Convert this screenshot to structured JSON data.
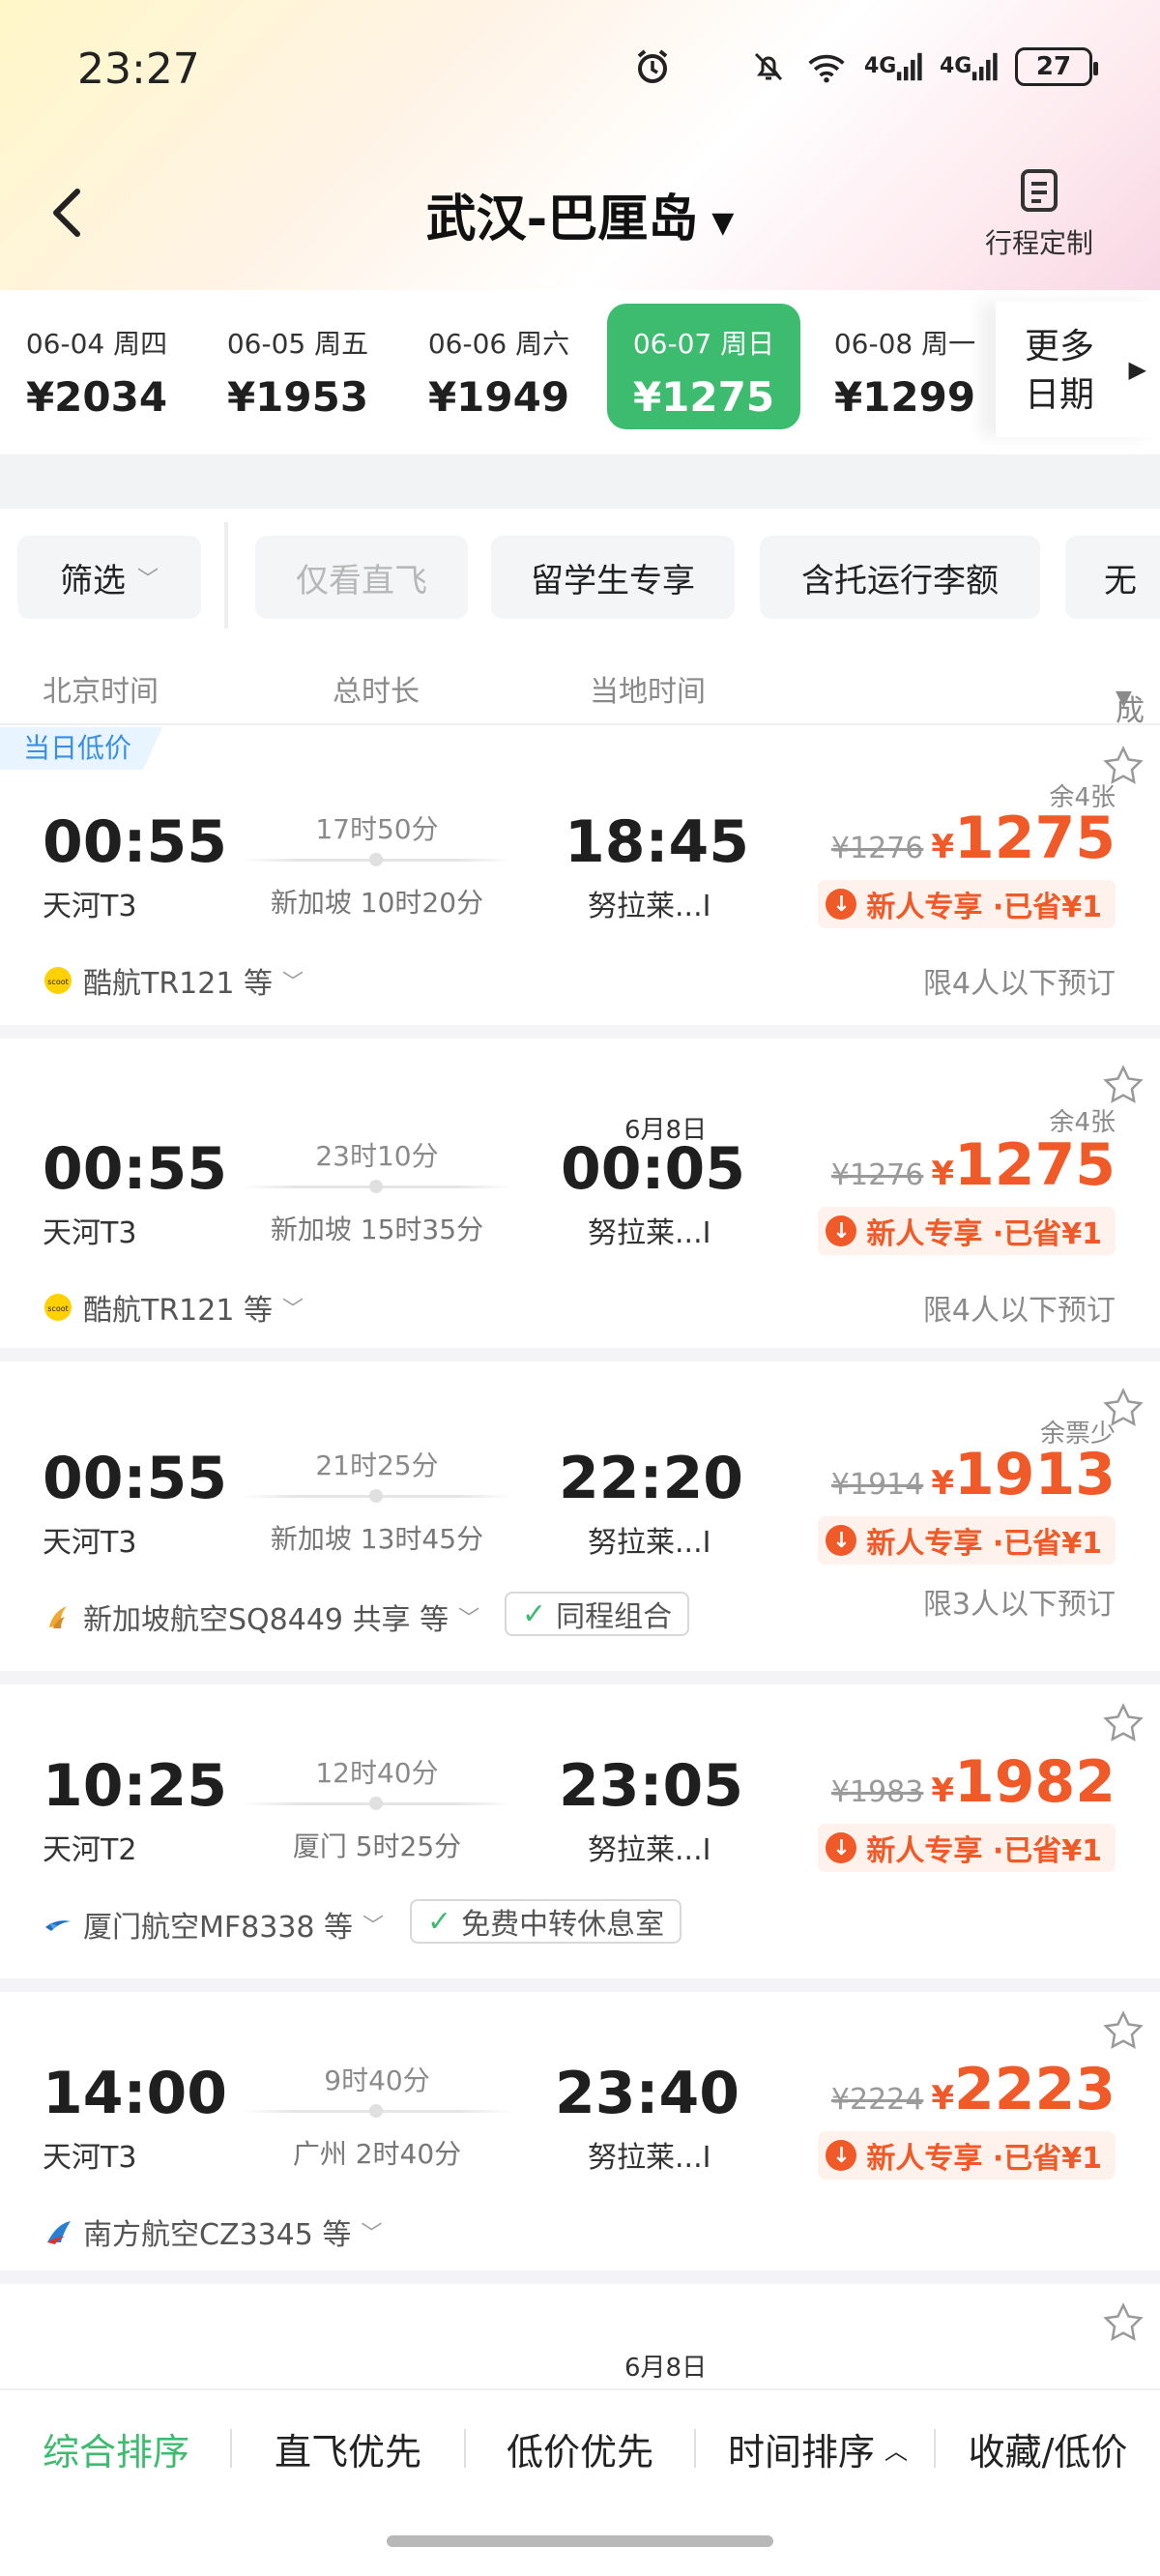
{
  "status_bar": {
    "time": "23:27",
    "network_1": "4G",
    "network_2": "4G",
    "battery": "27"
  },
  "nav": {
    "title": "武汉-巴厘岛",
    "custom_trip_label": "行程定制"
  },
  "dates": [
    {
      "date": "06-04 周四",
      "price": "¥2034"
    },
    {
      "date": "06-05 周五",
      "price": "¥1953"
    },
    {
      "date": "06-06 周六",
      "price": "¥1949"
    },
    {
      "date": "06-07 周日",
      "price": "¥1275",
      "active": true
    },
    {
      "date": "06-08 周一",
      "price": "¥1299"
    }
  ],
  "more_dates_label_1": "更多",
  "more_dates_label_2": "日期",
  "filters": {
    "filter": "筛选",
    "direct_only": "仅看直飞",
    "student": "留学生专享",
    "baggage": "含托运行李额",
    "partial": "无"
  },
  "columns": {
    "beijing_time": "北京时间",
    "duration": "总时长",
    "local_time": "当地时间",
    "price_sort": "成人含税价"
  },
  "flights": [
    {
      "badge": "当日低价",
      "dep_time": "00:55",
      "dep_term": "天河T3",
      "duration": "17时50分",
      "stop": "新加坡  10时20分",
      "arr_time": "18:45",
      "arr_term": "努拉莱...I",
      "next_day": "",
      "seats": "余4张",
      "old_price": "¥1276",
      "yen": "¥",
      "price": "1275",
      "promo": "新人专享 ·已省¥1",
      "airline": "酷航TR121 等",
      "tag": "",
      "limit": "限4人以下预订"
    },
    {
      "badge": "",
      "dep_time": "00:55",
      "dep_term": "天河T3",
      "duration": "23时10分",
      "stop": "新加坡  15时35分",
      "arr_time": "00:05",
      "arr_term": "努拉莱...I",
      "next_day": "6月8日",
      "seats": "余4张",
      "old_price": "¥1276",
      "yen": "¥",
      "price": "1275",
      "promo": "新人专享 ·已省¥1",
      "airline": "酷航TR121 等",
      "tag": "",
      "limit": "限4人以下预订"
    },
    {
      "badge": "",
      "dep_time": "00:55",
      "dep_term": "天河T3",
      "duration": "21时25分",
      "stop": "新加坡  13时45分",
      "arr_time": "22:20",
      "arr_term": "努拉莱...I",
      "next_day": "",
      "seats": "余票少",
      "old_price": "¥1914",
      "yen": "¥",
      "price": "1913",
      "promo": "新人专享 ·已省¥1",
      "airline": "新加坡航空SQ8449 共享 等",
      "tag": "同程组合",
      "limit": "限3人以下预订"
    },
    {
      "badge": "",
      "dep_time": "10:25",
      "dep_term": "天河T2",
      "duration": "12时40分",
      "stop": "厦门  5时25分",
      "arr_time": "23:05",
      "arr_term": "努拉莱...I",
      "next_day": "",
      "seats": "",
      "old_price": "¥1983",
      "yen": "¥",
      "price": "1982",
      "promo": "新人专享 ·已省¥1",
      "airline": "厦门航空MF8338 等",
      "tag": "免费中转休息室",
      "limit": ""
    },
    {
      "badge": "",
      "dep_time": "14:00",
      "dep_term": "天河T3",
      "duration": "9时40分",
      "stop": "广州  2时40分",
      "arr_time": "23:40",
      "arr_term": "努拉莱...I",
      "next_day": "",
      "seats": "",
      "old_price": "¥2224",
      "yen": "¥",
      "price": "2223",
      "promo": "新人专享 ·已省¥1",
      "airline": "南方航空CZ3345 等",
      "tag": "",
      "limit": ""
    }
  ],
  "partial_card_next_day": "6月8日",
  "sort_bar": {
    "overall": "综合排序",
    "direct": "直飞优先",
    "low_price": "低价优先",
    "time": "时间排序",
    "favorites": "收藏/低价"
  },
  "colors": {
    "accent_green": "#3dbb6f",
    "price_orange": "#f05a28",
    "badge_blue": "#3a8ee6"
  }
}
